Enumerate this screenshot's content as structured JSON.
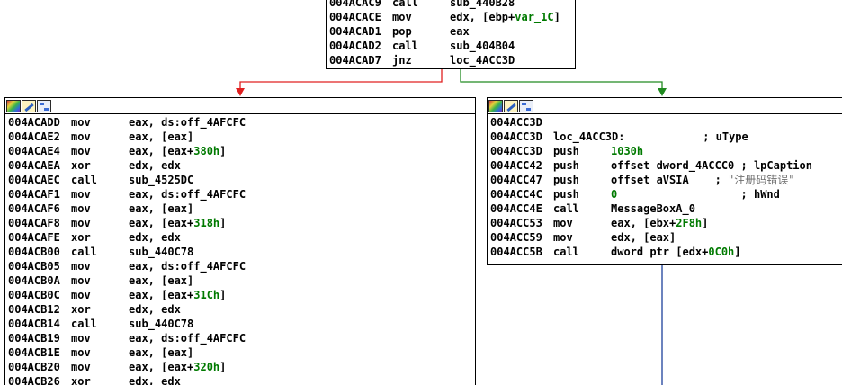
{
  "colors": {
    "edge_false": "#e02020",
    "edge_true": "#208a20",
    "edge_seq": "#3c5aa8",
    "immediate": "#007a00"
  },
  "header_icons": [
    "color-palette-icon",
    "edit-icon",
    "graph-overview-icon"
  ],
  "top_block": {
    "lines": [
      {
        "addr": "004ACAC9",
        "mnem": "call",
        "op": [
          {
            "t": "sub_440B28"
          }
        ],
        "comment": ""
      },
      {
        "addr": "004ACACE",
        "mnem": "mov",
        "op": [
          {
            "t": "edx, [ebp+"
          },
          {
            "t": "var_1C",
            "c": "vr"
          },
          {
            "t": "]"
          }
        ],
        "comment": ""
      },
      {
        "addr": "004ACAD1",
        "mnem": "pop",
        "op": [
          {
            "t": "eax"
          }
        ],
        "comment": ""
      },
      {
        "addr": "004ACAD2",
        "mnem": "call",
        "op": [
          {
            "t": "sub_404B04"
          }
        ],
        "comment": ""
      },
      {
        "addr": "004ACAD7",
        "mnem": "jnz",
        "op": [
          {
            "t": "loc_4ACC3D"
          }
        ],
        "comment": ""
      }
    ]
  },
  "left_block": {
    "lines": [
      {
        "addr": "004ACADD",
        "mnem": "mov",
        "op": [
          {
            "t": "eax, ds:off_4AFCFC"
          }
        ],
        "comment": ""
      },
      {
        "addr": "004ACAE2",
        "mnem": "mov",
        "op": [
          {
            "t": "eax, [eax]"
          }
        ],
        "comment": ""
      },
      {
        "addr": "004ACAE4",
        "mnem": "mov",
        "op": [
          {
            "t": "eax, [eax+"
          },
          {
            "t": "380h",
            "c": "num"
          },
          {
            "t": "]"
          }
        ],
        "comment": ""
      },
      {
        "addr": "004ACAEA",
        "mnem": "xor",
        "op": [
          {
            "t": "edx, edx"
          }
        ],
        "comment": ""
      },
      {
        "addr": "004ACAEC",
        "mnem": "call",
        "op": [
          {
            "t": "sub_4525DC"
          }
        ],
        "comment": ""
      },
      {
        "addr": "004ACAF1",
        "mnem": "mov",
        "op": [
          {
            "t": "eax, ds:off_4AFCFC"
          }
        ],
        "comment": ""
      },
      {
        "addr": "004ACAF6",
        "mnem": "mov",
        "op": [
          {
            "t": "eax, [eax]"
          }
        ],
        "comment": ""
      },
      {
        "addr": "004ACAF8",
        "mnem": "mov",
        "op": [
          {
            "t": "eax, [eax+"
          },
          {
            "t": "318h",
            "c": "num"
          },
          {
            "t": "]"
          }
        ],
        "comment": ""
      },
      {
        "addr": "004ACAFE",
        "mnem": "xor",
        "op": [
          {
            "t": "edx, edx"
          }
        ],
        "comment": ""
      },
      {
        "addr": "004ACB00",
        "mnem": "call",
        "op": [
          {
            "t": "sub_440C78"
          }
        ],
        "comment": ""
      },
      {
        "addr": "004ACB05",
        "mnem": "mov",
        "op": [
          {
            "t": "eax, ds:off_4AFCFC"
          }
        ],
        "comment": ""
      },
      {
        "addr": "004ACB0A",
        "mnem": "mov",
        "op": [
          {
            "t": "eax, [eax]"
          }
        ],
        "comment": ""
      },
      {
        "addr": "004ACB0C",
        "mnem": "mov",
        "op": [
          {
            "t": "eax, [eax+"
          },
          {
            "t": "31Ch",
            "c": "num"
          },
          {
            "t": "]"
          }
        ],
        "comment": ""
      },
      {
        "addr": "004ACB12",
        "mnem": "xor",
        "op": [
          {
            "t": "edx, edx"
          }
        ],
        "comment": ""
      },
      {
        "addr": "004ACB14",
        "mnem": "call",
        "op": [
          {
            "t": "sub_440C78"
          }
        ],
        "comment": ""
      },
      {
        "addr": "004ACB19",
        "mnem": "mov",
        "op": [
          {
            "t": "eax, ds:off_4AFCFC"
          }
        ],
        "comment": ""
      },
      {
        "addr": "004ACB1E",
        "mnem": "mov",
        "op": [
          {
            "t": "eax, [eax]"
          }
        ],
        "comment": ""
      },
      {
        "addr": "004ACB20",
        "mnem": "mov",
        "op": [
          {
            "t": "eax, [eax+"
          },
          {
            "t": "320h",
            "c": "num"
          },
          {
            "t": "]"
          }
        ],
        "comment": ""
      },
      {
        "addr": "004ACB26",
        "mnem": "xor",
        "op": [
          {
            "t": "edx, edx"
          }
        ],
        "comment": ""
      }
    ]
  },
  "right_block": {
    "lines": [
      {
        "addr": "004ACC3D",
        "mnem": "",
        "op": [],
        "comment": ""
      },
      {
        "addr": "004ACC3D",
        "mnem": "loc_4ACC3D:",
        "op": [
          {
            "t": "            "
          }
        ],
        "comment": "; uType"
      },
      {
        "addr": "004ACC3D",
        "mnem": "push",
        "op": [
          {
            "t": "1030h",
            "c": "num"
          }
        ],
        "comment": ""
      },
      {
        "addr": "004ACC42",
        "mnem": "push",
        "op": [
          {
            "t": "offset dword_4ACCC0 "
          }
        ],
        "comment": "; lpCaption"
      },
      {
        "addr": "004ACC47",
        "mnem": "push",
        "op": [
          {
            "t": "offset aVSIA    "
          }
        ],
        "comment": "; \"注册码错误\""
      },
      {
        "addr": "004ACC4C",
        "mnem": "push",
        "op": [
          {
            "t": "0",
            "c": "num"
          },
          {
            "t": "                   "
          }
        ],
        "comment": "; hWnd"
      },
      {
        "addr": "004ACC4E",
        "mnem": "call",
        "op": [
          {
            "t": "MessageBoxA_0"
          }
        ],
        "comment": ""
      },
      {
        "addr": "004ACC53",
        "mnem": "mov",
        "op": [
          {
            "t": "eax, [ebx+"
          },
          {
            "t": "2F8h",
            "c": "num"
          },
          {
            "t": "]"
          }
        ],
        "comment": ""
      },
      {
        "addr": "004ACC59",
        "mnem": "mov",
        "op": [
          {
            "t": "edx, [eax]"
          }
        ],
        "comment": ""
      },
      {
        "addr": "004ACC5B",
        "mnem": "call",
        "op": [
          {
            "t": "dword ptr [edx+"
          },
          {
            "t": "0C0h",
            "c": "num"
          },
          {
            "t": "]"
          }
        ],
        "comment": ""
      }
    ]
  }
}
